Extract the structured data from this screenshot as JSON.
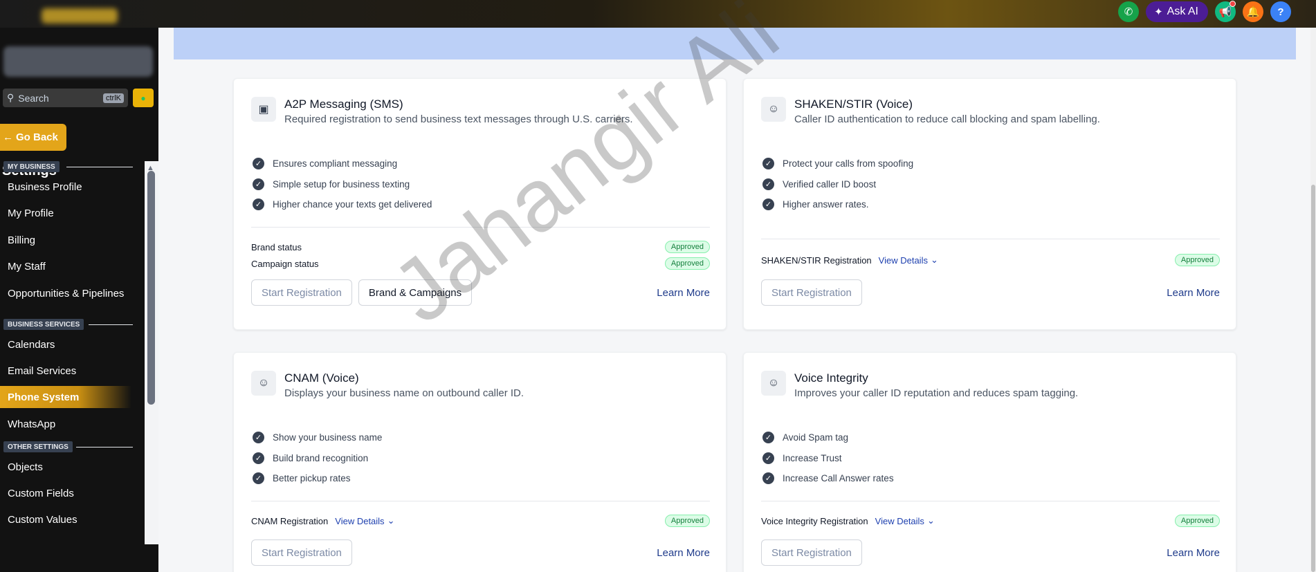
{
  "topbar": {
    "ask_ai_label": "Ask AI",
    "icons": [
      "phone-icon",
      "sparkle-icon",
      "megaphone-icon",
      "bell-icon",
      "help-icon"
    ],
    "colors": {
      "phone": "#16a34a",
      "ask_ai": "#4c1d95",
      "announce": "#10b981",
      "bell": "#f97316",
      "help": "#3b82f6"
    }
  },
  "sidebar": {
    "search_placeholder": "Search",
    "search_shortcut": "ctrlK",
    "go_back_label": "Go Back",
    "title": "Settings",
    "sections": [
      {
        "label": "MY BUSINESS",
        "items": [
          "Business Profile",
          "My Profile",
          "Billing",
          "My Staff",
          "Opportunities & Pipelines"
        ]
      },
      {
        "label": "BUSINESS SERVICES",
        "items": [
          "Calendars",
          "Email Services",
          "Phone System",
          "WhatsApp"
        ]
      },
      {
        "label": "OTHER SETTINGS",
        "items": [
          "Objects",
          "Custom Fields",
          "Custom Values"
        ]
      }
    ],
    "active_item": "Phone System",
    "accent_color": "#e3a51a"
  },
  "cards": [
    {
      "title": "A2P Messaging (SMS)",
      "description": "Required registration to send business text messages through U.S. carriers.",
      "icon": "chat-icon",
      "features": [
        "Ensures compliant messaging",
        "Simple setup for business texting",
        "Higher chance your texts get delivered"
      ],
      "statuses": [
        {
          "label": "Brand status",
          "badge": "Approved"
        },
        {
          "label": "Campaign status",
          "badge": "Approved"
        }
      ],
      "buttons": [
        "Start Registration",
        "Brand & Campaigns"
      ],
      "learn_more": "Learn More"
    },
    {
      "title": "SHAKEN/STIR (Voice)",
      "description": "Caller ID authentication to reduce call blocking and spam labelling.",
      "icon": "caller-id-icon",
      "features": [
        "Protect your calls from spoofing",
        "Verified caller ID boost",
        "Higher answer rates."
      ],
      "registration": {
        "label": "SHAKEN/STIR Registration",
        "view_details": "View Details",
        "badge": "Approved"
      },
      "buttons": [
        "Start Registration"
      ],
      "learn_more": "Learn More"
    },
    {
      "title": "CNAM (Voice)",
      "description": "Displays your business name on outbound caller ID.",
      "icon": "caller-id-icon",
      "features": [
        "Show your business name",
        "Build brand recognition",
        "Better pickup rates"
      ],
      "registration": {
        "label": "CNAM Registration",
        "view_details": "View Details",
        "badge": "Approved"
      },
      "buttons": [
        "Start Registration"
      ],
      "learn_more": "Learn More"
    },
    {
      "title": "Voice Integrity",
      "description": "Improves your caller ID reputation and reduces spam tagging.",
      "icon": "caller-id-icon",
      "features": [
        "Avoid Spam tag",
        "Increase Trust",
        "Increase Call Answer rates"
      ],
      "registration": {
        "label": "Voice Integrity Registration",
        "view_details": "View Details",
        "badge": "Approved"
      },
      "buttons": [
        "Start Registration"
      ],
      "learn_more": "Learn More"
    }
  ],
  "watermark": "Jahangir Ali"
}
